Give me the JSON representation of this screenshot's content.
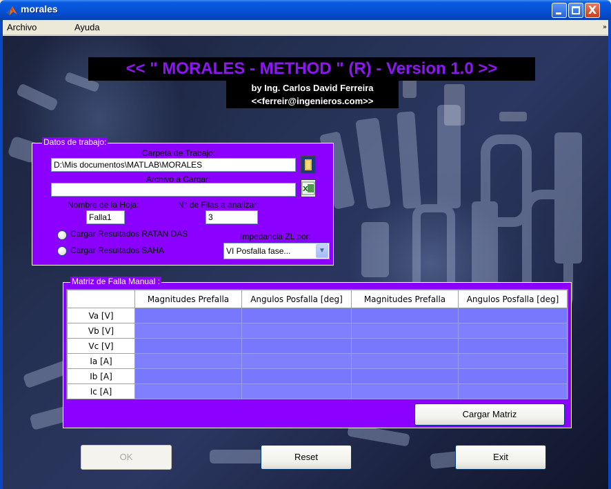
{
  "window": {
    "title": "morales",
    "minimize": "minimize",
    "maximize": "maximize",
    "close": "X"
  },
  "menubar": {
    "items": [
      "Archivo",
      "Ayuda"
    ],
    "overflow_arrow": "»"
  },
  "header": {
    "title": "<< \"  MORALES - METHOD \" (R) - Version 1.0 >>",
    "author": "by Ing. Carlos David Ferreira",
    "email": "<<ferreir@ingenieros.com>>"
  },
  "datos": {
    "panel_title": "Datos de trabajo:",
    "carpeta_label": "Carpeta de Trabajo:",
    "carpeta_value": "D:\\Mis documentos\\MATLAB\\MORALES",
    "archivo_label": "Archivo a Cargar:",
    "archivo_value": "",
    "hoja_label": "Nombre de la Hoja:",
    "hoja_value": "Falla1",
    "filas_label": "N° de Filas a analizar:",
    "filas_value": "3",
    "radio_ratan": "Cargar Resultados RATAN DAS",
    "radio_saha": "Cargar Resultados SAHA",
    "impedancia_label": "Impedancia ZL por:",
    "impedancia_value": "VI Posfalla fase...",
    "folder_icon": "folder-icon",
    "excel_icon": "excel-icon"
  },
  "matriz": {
    "panel_title": "Matriz de Falla Manual :",
    "columns": [
      "Magnitudes Prefalla",
      "Angulos Posfalla [deg]",
      "Magnitudes Prefalla",
      "Angulos Posfalla [deg]"
    ],
    "rows": [
      "Va [V]",
      "Vb [V]",
      "Vc [V]",
      "Ia [A]",
      "Ib [A]",
      "Ic [A]"
    ],
    "load_button": "Cargar Matriz"
  },
  "buttons": {
    "ok": "OK",
    "reset": "Reset",
    "exit": "Exit"
  },
  "colors": {
    "panel": "#8b00ff",
    "title_text": "#8e16f2",
    "cell": "#7878ff"
  }
}
